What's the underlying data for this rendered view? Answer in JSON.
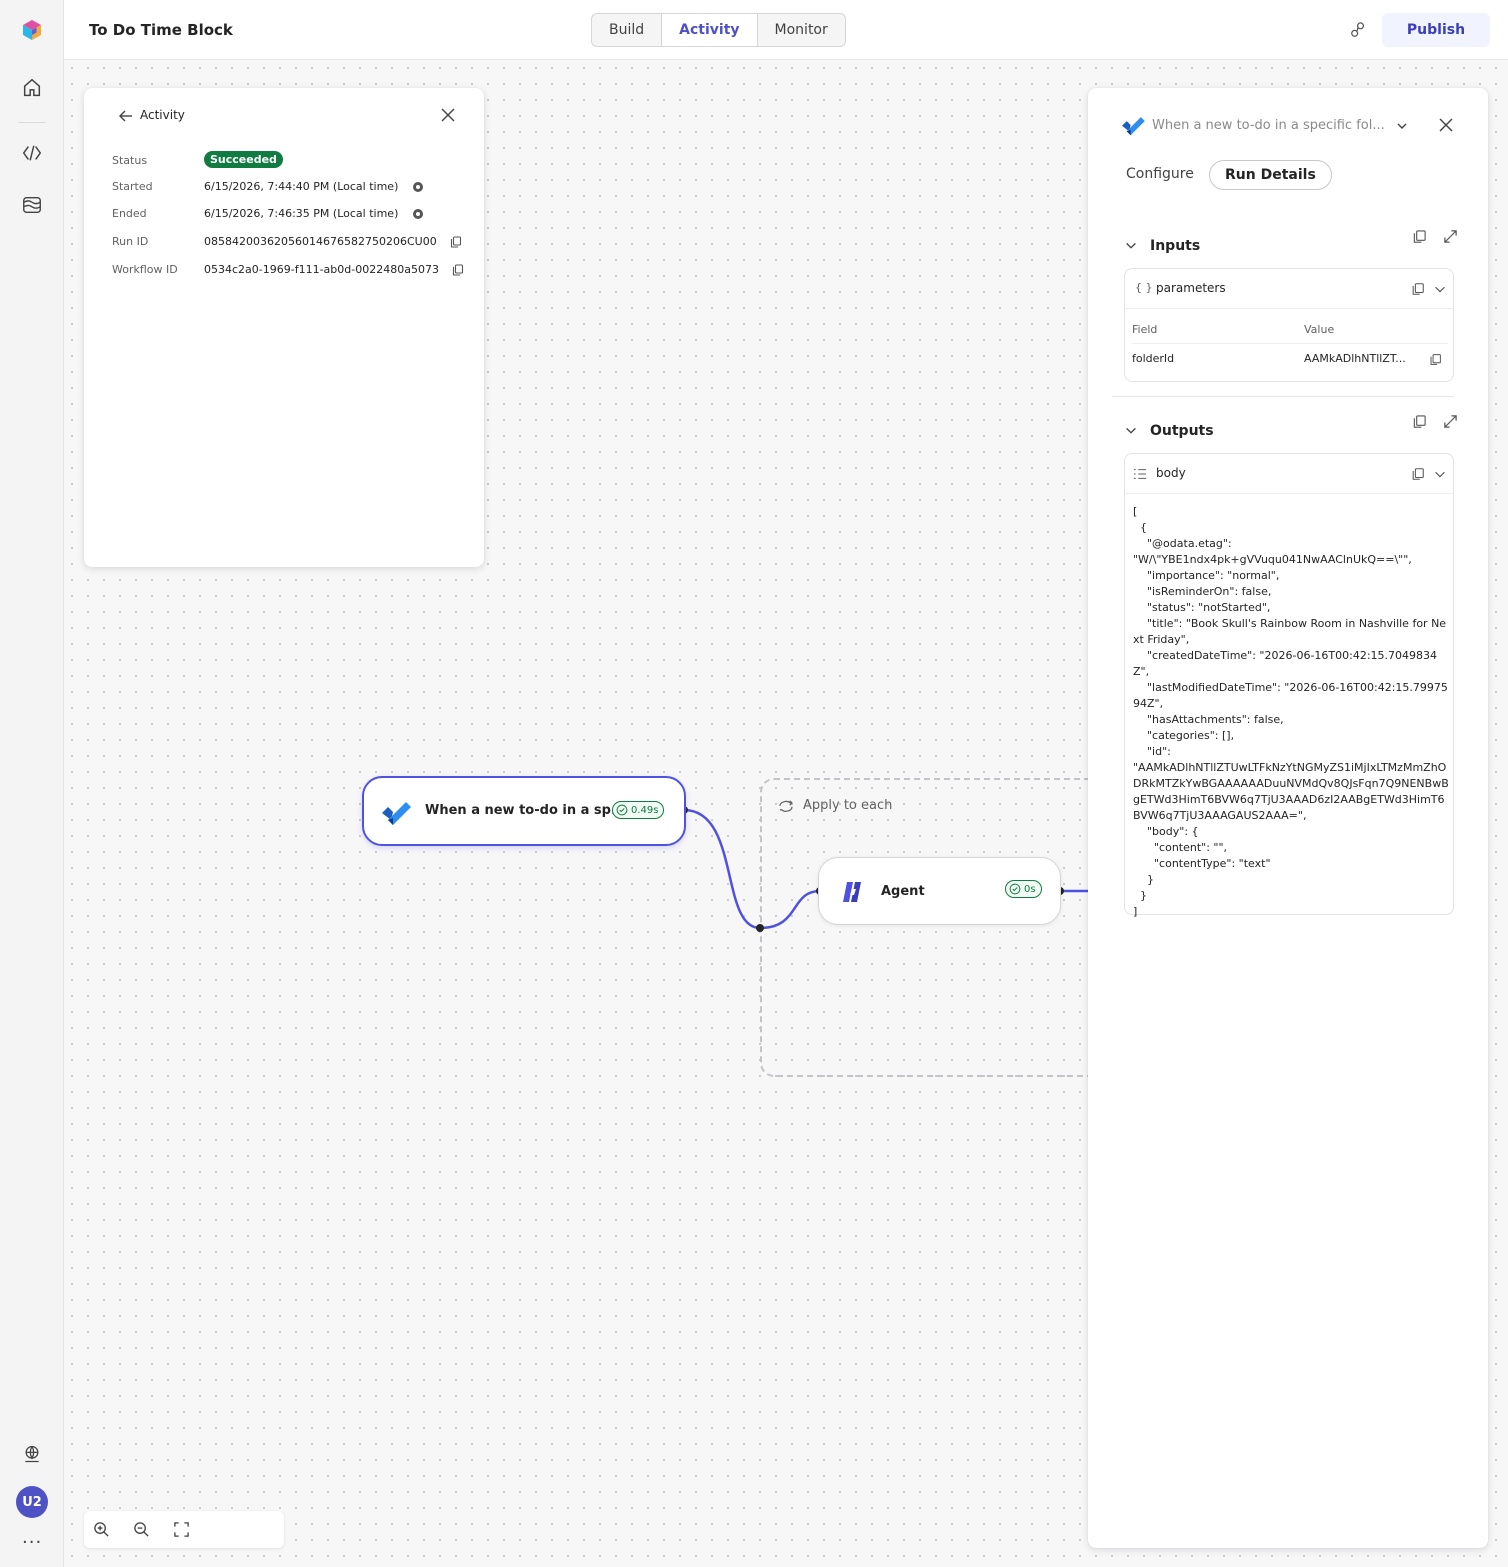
{
  "app": {
    "title": "To Do Time Block",
    "tabs": [
      "Build",
      "Activity",
      "Monitor"
    ],
    "active_tab": "Activity",
    "publish_label": "Publish"
  },
  "rail": {
    "user_initials": "U2",
    "more_label": "···"
  },
  "activity_panel": {
    "title": "Activity",
    "status_label": "Status",
    "status_value": "Succeeded",
    "started_label": "Started",
    "started_value": "6/15/2026, 7:44:40 PM (Local time)",
    "ended_label": "Ended",
    "ended_value": "6/15/2026, 7:46:35 PM (Local time)",
    "run_id_label": "Run ID",
    "run_id_value": "08584200362056014676582750206CU00",
    "workflow_id_label": "Workflow ID",
    "workflow_id_value": "0534c2a0-1969-f111-ab0d-0022480a5073"
  },
  "canvas": {
    "trigger_label": "When a new to-do in a sp...",
    "trigger_duration": "0.49s",
    "loop_label": "Apply to each",
    "agent_label": "Agent",
    "agent_duration": "0s"
  },
  "details_panel": {
    "title": "When a new to-do in a specific fol...",
    "tab_configure": "Configure",
    "tab_run_details": "Run Details",
    "active_tab": "Run Details",
    "inputs": {
      "heading": "Inputs",
      "card_icon": "{ }",
      "card_label": "parameters",
      "field_header": "Field",
      "value_header": "Value",
      "field": "folderId",
      "value": "AAMkADlhNTllZT..."
    },
    "outputs": {
      "heading": "Outputs",
      "card_label": "body",
      "json_text": "[\n  {\n    \"@odata.etag\":\n\"W/\\\"YBE1ndx4pk+gVVuqu041NwAAClnUkQ==\\\"\",\n    \"importance\": \"normal\",\n    \"isReminderOn\": false,\n    \"status\": \"notStarted\",\n    \"title\": \"Book Skull's Rainbow Room in Nashville for Next Friday\",\n    \"createdDateTime\": \"2026-06-16T00:42:15.7049834Z\",\n    \"lastModifiedDateTime\": \"2026-06-16T00:42:15.7997594Z\",\n    \"hasAttachments\": false,\n    \"categories\": [],\n    \"id\":\n\"AAMkADlhNTllZTUwLTFkNzYtNGMyZS1iMjIxLTMzMmZhODRkMTZkYwBGAAAAAADuuNVMdQv8QJsFqn7Q9NENBwBgETWd3HimT6BVW6q7TjU3AAAD6zI2AABgETWd3HimT6BVW6q7TjU3AAAGAUS2AAA=\",\n    \"body\": {\n      \"content\": \"\",\n      \"contentType\": \"text\"\n    }\n  }\n]"
    }
  },
  "colors": {
    "accent": "#4f52c4",
    "success": "#107c41",
    "todo_blue": "#2564cf"
  }
}
